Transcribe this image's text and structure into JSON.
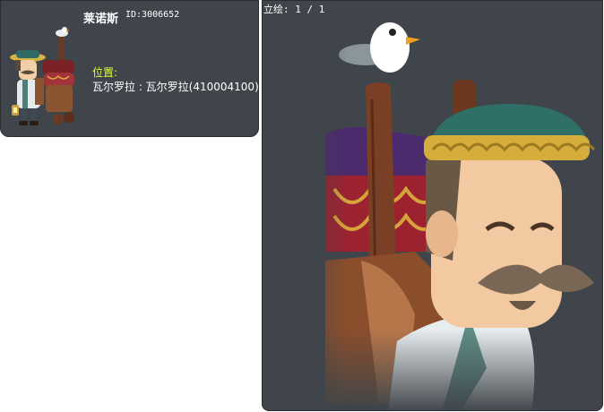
{
  "info": {
    "name": "莱诺斯",
    "id_text": "ID:3006652",
    "location_label": "位置:",
    "location_value": "瓦尔罗拉 : 瓦尔罗拉(410004100)"
  },
  "portrait": {
    "counter_text": "立绘: 1 / 1"
  },
  "colors": {
    "panel_bg": "#3f454a",
    "location_label": "#d9ff35",
    "text": "#ffffff"
  }
}
